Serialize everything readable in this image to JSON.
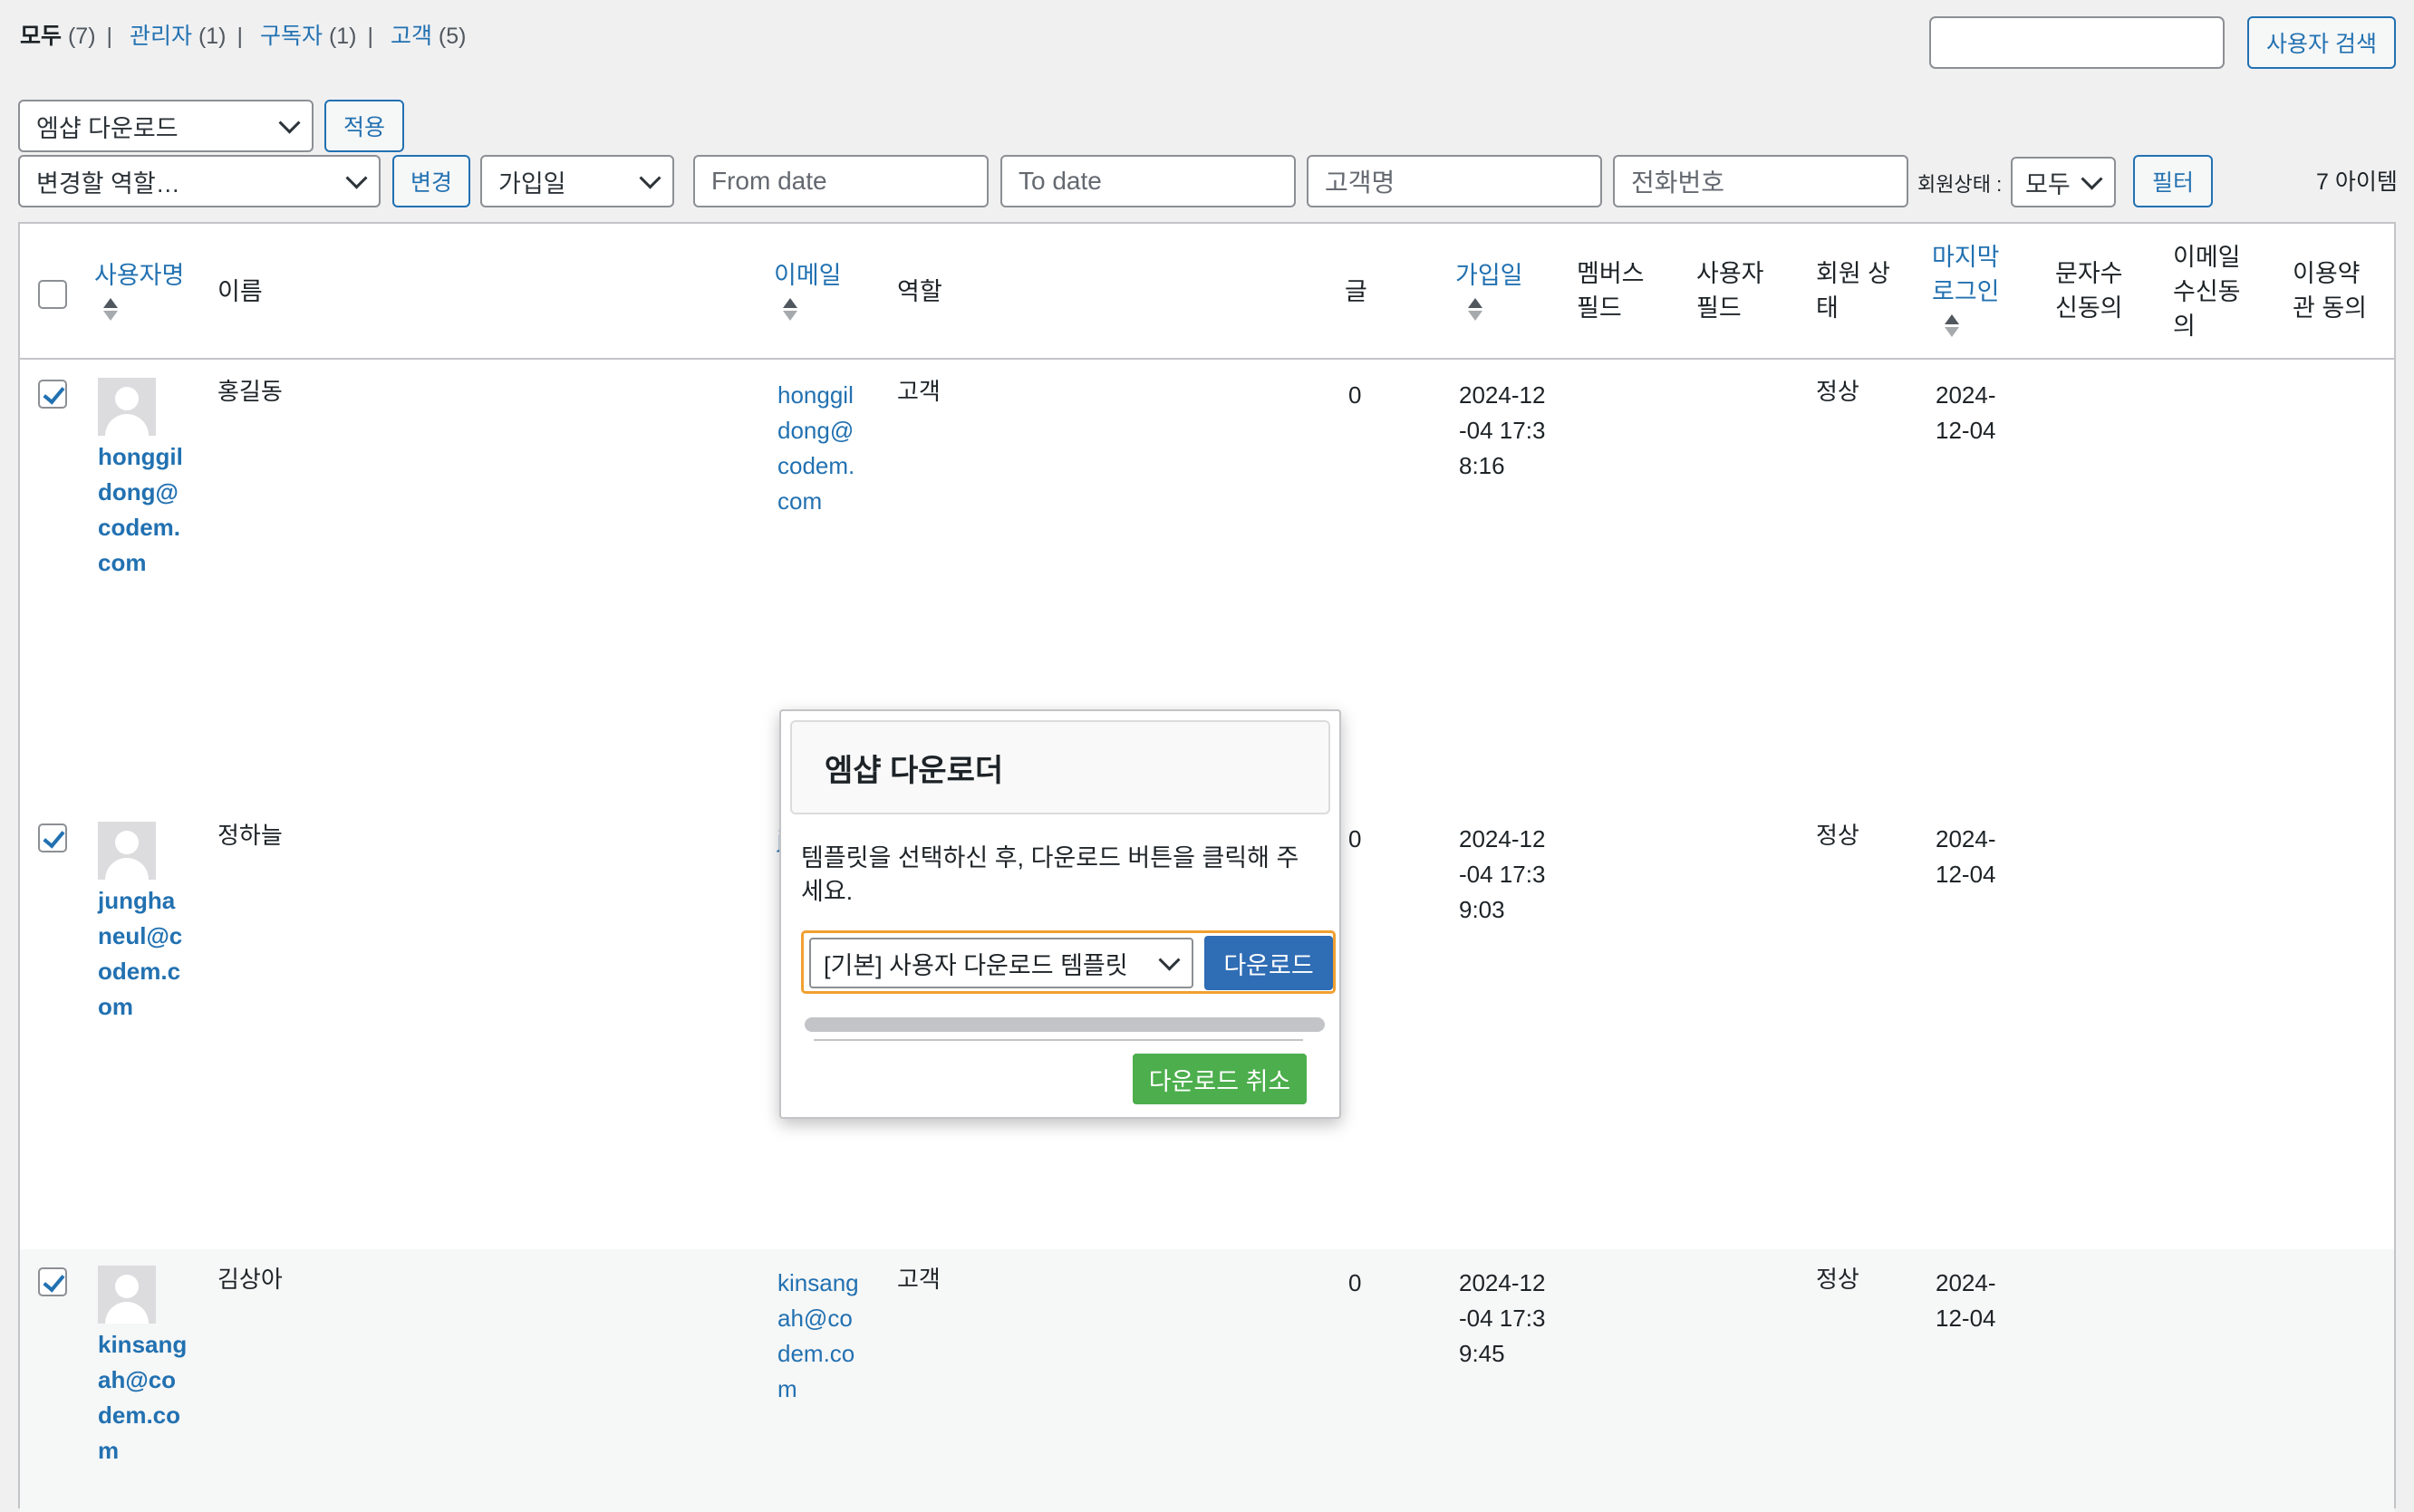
{
  "views": [
    {
      "label": "모두",
      "count": "(7)",
      "current": true
    },
    {
      "label": "관리자",
      "count": "(1)",
      "current": false
    },
    {
      "label": "구독자",
      "count": "(1)",
      "current": false
    },
    {
      "label": "고객",
      "count": "(5)",
      "current": false
    }
  ],
  "search": {
    "value": "",
    "button": "사용자 검색"
  },
  "bulk": {
    "action": "엠샵 다운로드",
    "apply": "적용"
  },
  "role_change": {
    "placeholder": "변경할 역할…",
    "button": "변경"
  },
  "filters": {
    "date_type": "가입일",
    "from_date": "From date",
    "to_date": "To date",
    "customer_name": "고객명",
    "phone": "전화번호",
    "status_label": "회원상태 :",
    "status_value": "모두",
    "filter_button": "필터"
  },
  "item_count": "7 아이템",
  "columns": {
    "username": "사용자명",
    "name": "이름",
    "email": "이메일",
    "role": "역할",
    "posts": "글",
    "registered": "가입일",
    "members_field": "멤버스 필드",
    "user_field": "사용자 필드",
    "member_status": "회원 상태",
    "last_login": "마지막 로그인",
    "sms_consent": "문자수신동의",
    "email_consent": "이메일 수신동의",
    "terms_consent": "이용약관 동의"
  },
  "rows": [
    {
      "username": "honggildong@codem.com",
      "name": "홍길동",
      "email": "honggildong@codem.com",
      "role": "고객",
      "posts": "0",
      "registered": "2024-12-04 17:38:16",
      "status": "정상",
      "last_login": "2024-12-04",
      "checked": true
    },
    {
      "username": "jungha neul@codem.com",
      "name": "정하늘",
      "email": "j",
      "role": "",
      "posts": "0",
      "registered": "2024-12-04 17:39:03",
      "status": "정상",
      "last_login": "2024-12-04",
      "checked": true
    },
    {
      "username": "kinsangah@codem.com",
      "name": "김상아",
      "email": "kinsangah@codem.com",
      "role": "고객",
      "posts": "0",
      "registered": "2024-12-04 17:39:45",
      "status": "정상",
      "last_login": "2024-12-04",
      "checked": true
    }
  ],
  "modal": {
    "title": "엠샵 다운로더",
    "message": "템플릿을 선택하신 후, 다운로드 버튼을 클릭해 주세요.",
    "template": "[기본] 사용자 다운로드 템플릿",
    "download": "다운로드",
    "cancel": "다운로드 취소",
    "progress": 1.0
  },
  "colors": {
    "link": "#2271b1",
    "primary": "#2f6db5",
    "success": "#4cae4c",
    "focus": "#f0a030"
  }
}
